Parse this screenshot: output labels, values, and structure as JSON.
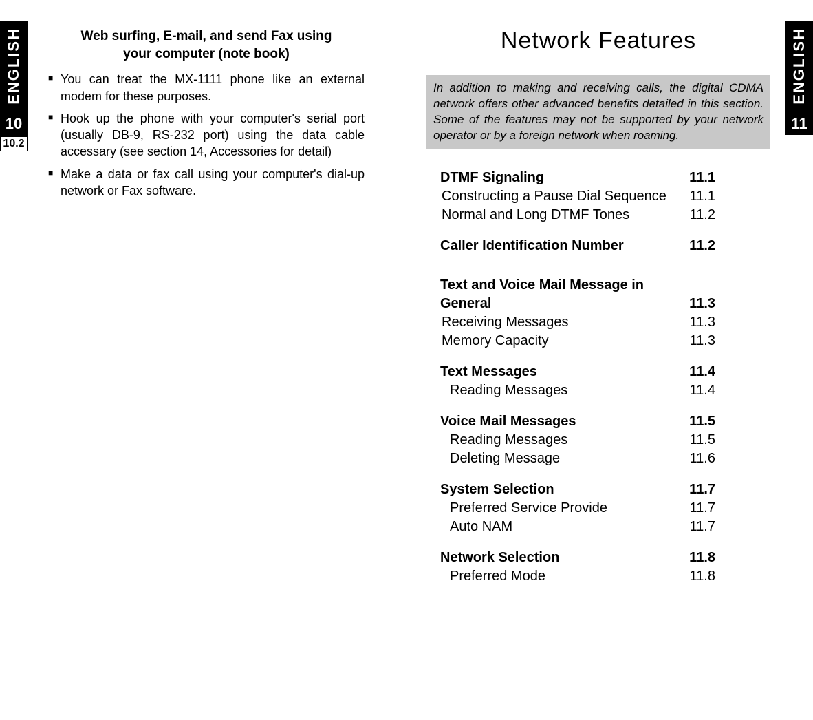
{
  "language_label": "ENGLISH",
  "left_tab": {
    "chapter": "10",
    "sub": "10.2"
  },
  "right_tab": {
    "chapter": "11"
  },
  "left_page": {
    "heading_line1": "Web surfing, E-mail, and send Fax using",
    "heading_line2": "your computer (note book)",
    "bullets": [
      "You can treat the MX-1111 phone like an external modem for these purposes.",
      "Hook up the phone with your computer's serial port (usually DB-9, RS-232 port) using the data cable accessary (see section 14, Accessories for detail)",
      "Make a data or fax call using your computer's dial-up network or Fax software."
    ]
  },
  "right_page": {
    "title": "Network Features",
    "intro": "In addition to making and receiving calls, the digital CDMA network offers other advanced benefits detailed in this section. Some of the features may not be supported by your network operator or by a foreign network when roaming.",
    "toc": [
      {
        "label": "DTMF Signaling",
        "page": "11.1",
        "type": "bold"
      },
      {
        "label": "Constructing a Pause Dial Sequence",
        "page": "11.1",
        "type": "sub"
      },
      {
        "label": "Normal and Long DTMF Tones",
        "page": "11.2",
        "type": "sub"
      },
      {
        "label": "Caller Identification Number",
        "page": "11.2",
        "type": "bold"
      },
      {
        "label": "Text and Voice Mail Message in General",
        "page": "11.3",
        "type": "bold-multi"
      },
      {
        "label": "Receiving Messages",
        "page": "11.3",
        "type": "sub"
      },
      {
        "label": "Memory Capacity",
        "page": "11.3",
        "type": "sub"
      },
      {
        "label": "Text Messages",
        "page": "11.4",
        "type": "bold"
      },
      {
        "label": "Reading Messages",
        "page": "11.4",
        "type": "indent"
      },
      {
        "label": "Voice Mail Messages",
        "page": "11.5",
        "type": "bold"
      },
      {
        "label": "Reading Messages",
        "page": "11.5",
        "type": "indent"
      },
      {
        "label": "Deleting Message",
        "page": "11.6",
        "type": "indent"
      },
      {
        "label": "System Selection",
        "page": "11.7",
        "type": "bold"
      },
      {
        "label": "Preferred Service Provide",
        "page": "11.7",
        "type": "indent"
      },
      {
        "label": "Auto NAM",
        "page": "11.7",
        "type": "indent"
      },
      {
        "label": "Network Selection",
        "page": "11.8",
        "type": "bold"
      },
      {
        "label": "Preferred Mode",
        "page": "11.8",
        "type": "indent"
      }
    ]
  }
}
